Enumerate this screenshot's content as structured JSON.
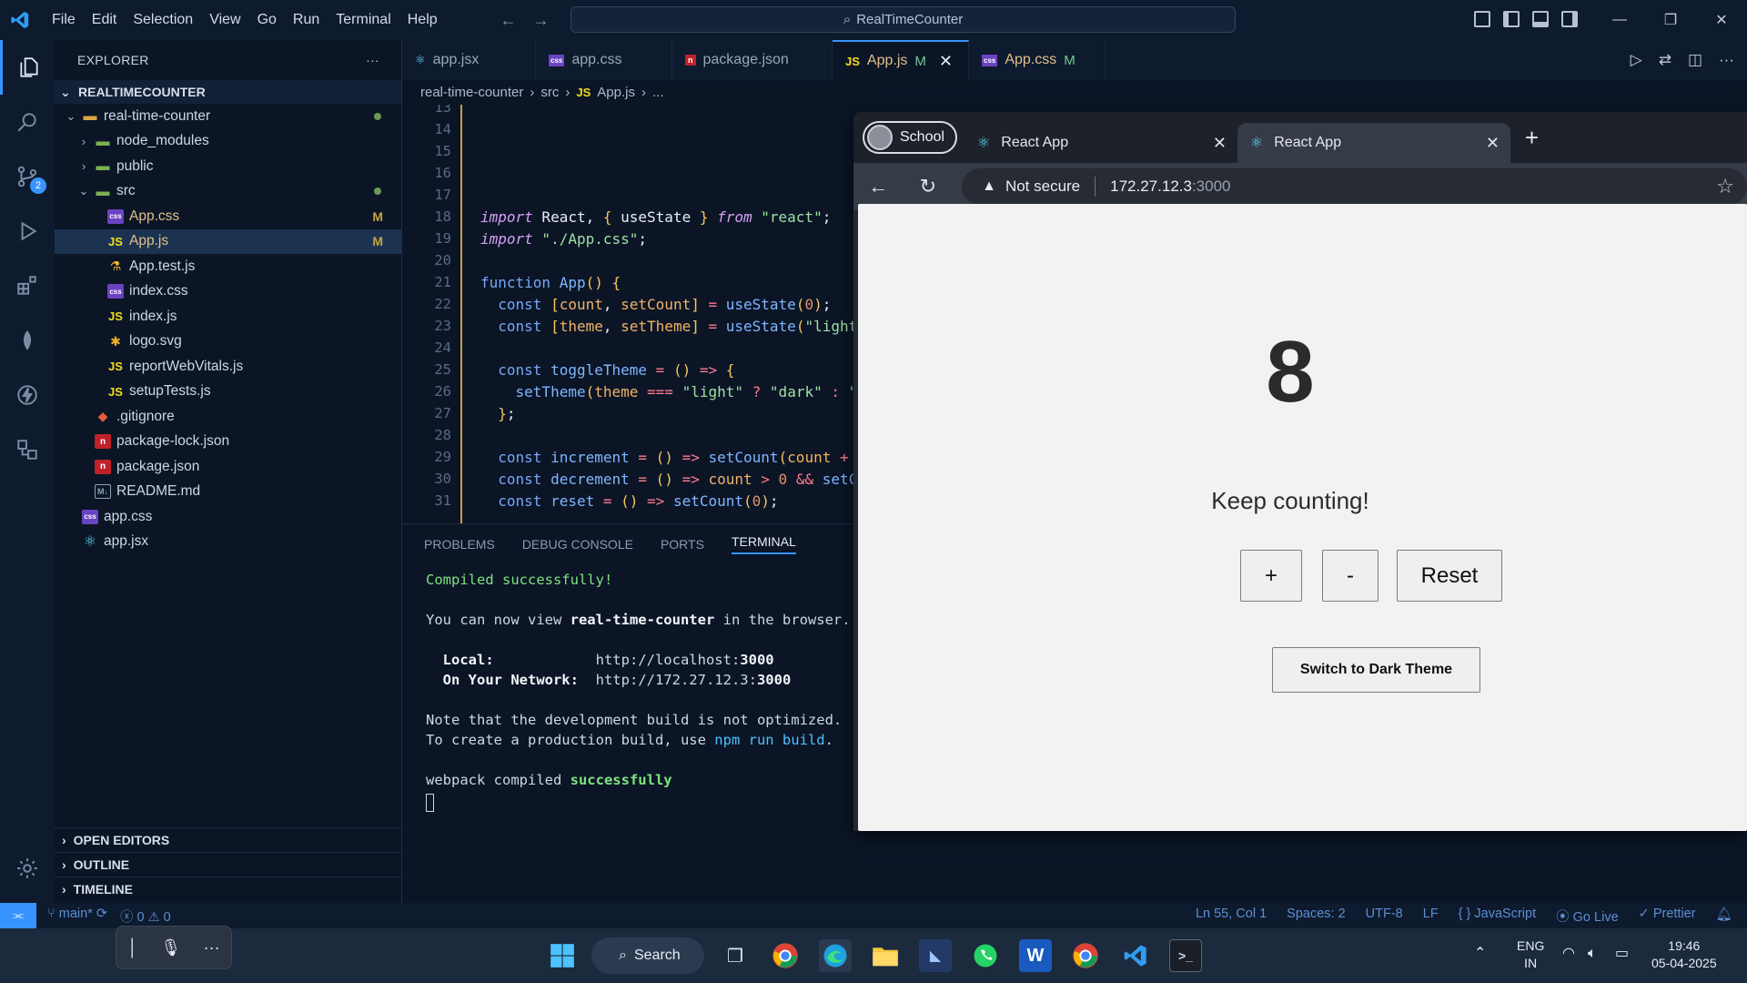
{
  "window": {
    "title": "RealTimeCounter",
    "menu": [
      "File",
      "Edit",
      "Selection",
      "View",
      "Go",
      "Run",
      "Terminal",
      "Help"
    ]
  },
  "activity": {
    "scm_badge": "2"
  },
  "sidebar": {
    "header": "EXPLORER",
    "project": "REALTIMECOUNTER",
    "tree": [
      {
        "label": "real-time-counter",
        "indent": 1,
        "kind": "folder",
        "twisty": "open",
        "dot": true
      },
      {
        "label": "node_modules",
        "indent": 2,
        "kind": "folder-g",
        "twisty": "closed"
      },
      {
        "label": "public",
        "indent": 2,
        "kind": "folder-g",
        "twisty": "closed"
      },
      {
        "label": "src",
        "indent": 2,
        "kind": "folder-g",
        "twisty": "open",
        "dot": true
      },
      {
        "label": "App.css",
        "indent": 3,
        "kind": "css",
        "mod": "M"
      },
      {
        "label": "App.js",
        "indent": 3,
        "kind": "js",
        "mod": "M",
        "selected": true
      },
      {
        "label": "App.test.js",
        "indent": 3,
        "kind": "test"
      },
      {
        "label": "index.css",
        "indent": 3,
        "kind": "css"
      },
      {
        "label": "index.js",
        "indent": 3,
        "kind": "js"
      },
      {
        "label": "logo.svg",
        "indent": 3,
        "kind": "svg"
      },
      {
        "label": "reportWebVitals.js",
        "indent": 3,
        "kind": "js"
      },
      {
        "label": "setupTests.js",
        "indent": 3,
        "kind": "js"
      },
      {
        "label": ".gitignore",
        "indent": 2,
        "kind": "git"
      },
      {
        "label": "package-lock.json",
        "indent": 2,
        "kind": "json"
      },
      {
        "label": "package.json",
        "indent": 2,
        "kind": "json"
      },
      {
        "label": "README.md",
        "indent": 2,
        "kind": "md"
      },
      {
        "label": "app.css",
        "indent": 1,
        "kind": "css"
      },
      {
        "label": "app.jsx",
        "indent": 1,
        "kind": "react"
      }
    ],
    "sections": [
      "OPEN EDITORS",
      "OUTLINE",
      "TIMELINE"
    ]
  },
  "tabs": [
    {
      "label": "app.jsx",
      "kind": "react"
    },
    {
      "label": "app.css",
      "kind": "css"
    },
    {
      "label": "package.json",
      "kind": "json"
    },
    {
      "label": "App.js",
      "kind": "js",
      "mod": "M",
      "active": true
    },
    {
      "label": "App.css",
      "kind": "css",
      "mod": "M"
    }
  ],
  "breadcrumb": [
    "real-time-counter",
    "src",
    "App.js",
    "..."
  ],
  "editor": {
    "line_numbers": [
      "13",
      "14",
      "15",
      "16",
      "17",
      "18",
      "19",
      "20",
      "21",
      "22",
      "23",
      "24",
      "25",
      "26",
      "27",
      "28",
      "29",
      "30",
      "31"
    ]
  },
  "panel": {
    "tabs": [
      "PROBLEMS",
      "DEBUG CONSOLE",
      "PORTS",
      "TERMINAL"
    ],
    "active_tab": "TERMINAL",
    "compiled": "Compiled successfully!",
    "view_line_a": "You can now view ",
    "view_app": "real-time-counter",
    "view_line_b": " in the browser.",
    "local_label": "  Local:            ",
    "local_url": "http://localhost:",
    "local_port": "3000",
    "network_label": "  On Your Network:  ",
    "network_url": "http://172.27.12.3:",
    "network_port": "3000",
    "note1": "Note that the development build is not optimized.",
    "note2_a": "To create a production build, use ",
    "note2_cmd": "npm run build",
    "note2_b": ".",
    "webpack_a": "webpack compiled ",
    "webpack_b": "successfully"
  },
  "browser": {
    "profile": "School",
    "tab1": "React App",
    "tab2": "React App",
    "security": "Not secure",
    "url_host": "172.27.12.3",
    "url_port": ":3000"
  },
  "app": {
    "count": "8",
    "message": "Keep counting!",
    "plus": "+",
    "minus": "-",
    "reset": "Reset",
    "theme_button": "Switch to Dark Theme"
  },
  "status": {
    "branch": "main*",
    "errors": "0",
    "warnings": "0",
    "position": "Ln 55, Col 1",
    "spaces": "Spaces: 2",
    "encoding": "UTF-8",
    "eol": "LF",
    "language": "JavaScript",
    "golive": "Go Live",
    "prettier": "Prettier"
  },
  "taskbar": {
    "search": "Search",
    "lang1": "ENG",
    "lang2": "IN",
    "time": "19:46",
    "date": "05-04-2025"
  }
}
